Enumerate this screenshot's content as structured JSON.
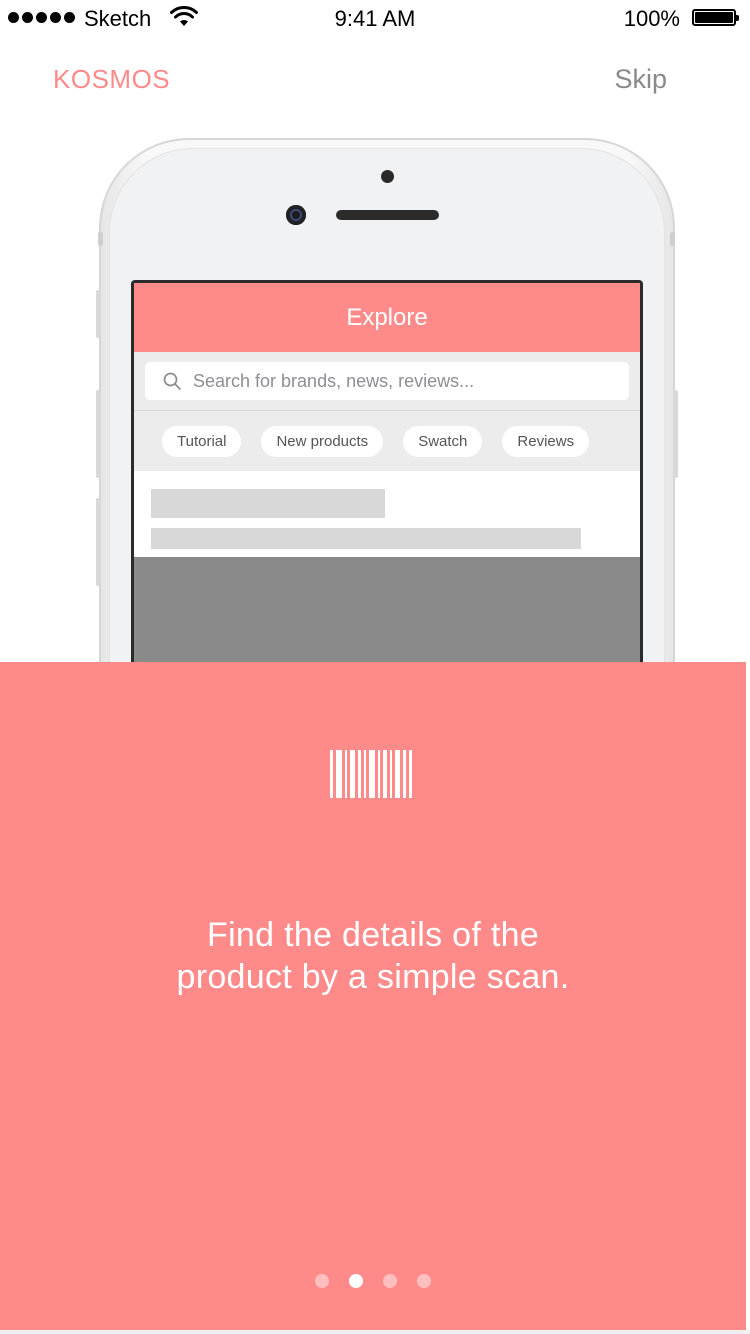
{
  "status_bar": {
    "carrier": "Sketch",
    "time": "9:41 AM",
    "battery": "100%"
  },
  "nav": {
    "brand": "KOSMOS",
    "skip_label": "Skip"
  },
  "mockup": {
    "title": "Explore",
    "search_placeholder": "Search for brands, news, reviews...",
    "tags": [
      "Tutorial",
      "New products",
      "Swatch",
      "Reviews"
    ]
  },
  "onboarding": {
    "line1": "Find the details of the",
    "line2": "product by a simple scan.",
    "page_count": 4,
    "active_page": 2
  },
  "colors": {
    "accent": "#FF8A8A",
    "skip": "#8a8a8a"
  },
  "icons": {
    "search": "search-icon",
    "barcode": "barcode-icon",
    "wifi": "wifi-icon",
    "battery": "battery-icon"
  }
}
